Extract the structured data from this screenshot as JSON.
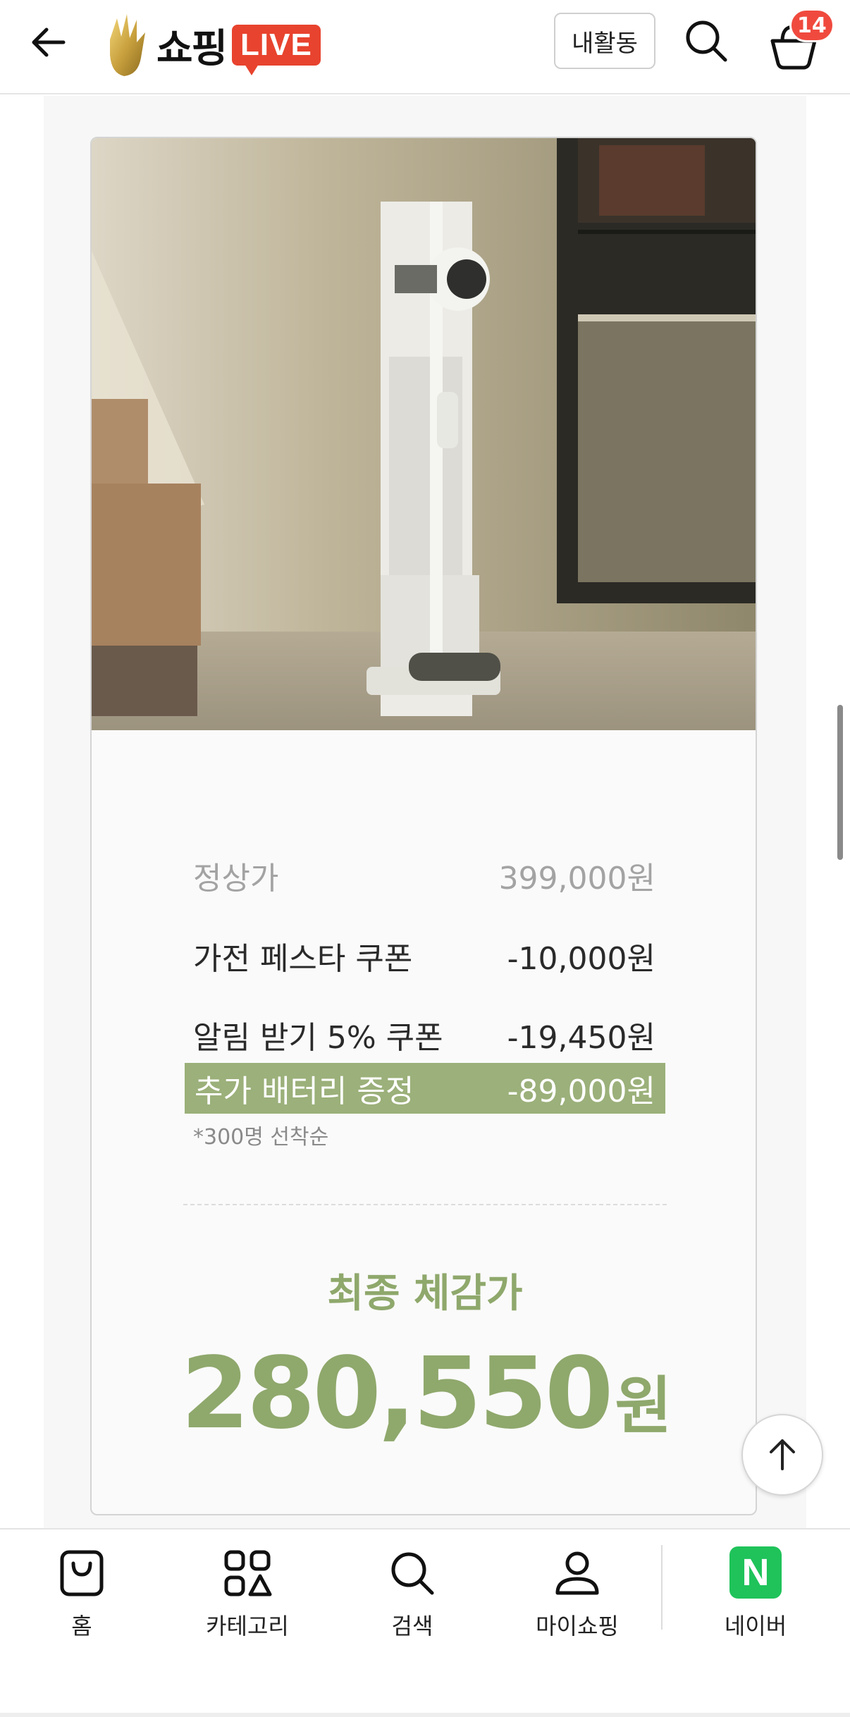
{
  "header": {
    "logo_text": "쇼핑",
    "logo_live": "LIVE",
    "activity_label": "내활동",
    "cart_count": "14"
  },
  "product": {
    "image_alt": "vacuum-cleaner-photo",
    "prices": [
      {
        "label": "정상가",
        "value": "399,000원",
        "style": "muted"
      },
      {
        "label": "가전 페스타 쿠폰",
        "value": "-10,000원",
        "style": "normal"
      },
      {
        "label": "알림 받기 5% 쿠폰",
        "value": "-19,450원",
        "style": "normal"
      },
      {
        "label": "추가 배터리 증정",
        "value": "-89,000원",
        "style": "highlight"
      }
    ],
    "note": "*300명 선착순",
    "final_label": "최종 체감가",
    "final_price": "280,550",
    "final_unit": "원"
  },
  "nav": {
    "items": [
      {
        "label": "홈",
        "icon": "bag-icon"
      },
      {
        "label": "카테고리",
        "icon": "category-icon"
      },
      {
        "label": "검색",
        "icon": "search-icon"
      },
      {
        "label": "마이쇼핑",
        "icon": "person-icon"
      },
      {
        "label": "네이버",
        "icon": "naver-icon",
        "icon_text": "N"
      }
    ]
  },
  "colors": {
    "accent_green": "#8fa86c",
    "highlight_green": "#9bb07a",
    "live_red": "#e8432e",
    "badge_red": "#f04a3e",
    "naver_green": "#1fc35a"
  }
}
